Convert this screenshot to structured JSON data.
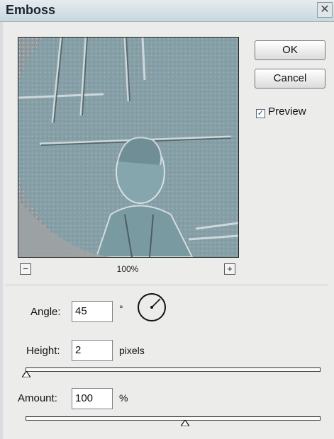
{
  "dialog": {
    "title": "Emboss",
    "close_glyph": "✕",
    "buttons": {
      "ok": "OK",
      "cancel": "Cancel"
    },
    "preview_checkbox": {
      "label": "Preview",
      "checked": true,
      "check_glyph": "✓"
    },
    "zoom": {
      "level": "100%",
      "zoom_out_glyph": "−",
      "zoom_in_glyph": "+"
    },
    "angle": {
      "label": "Angle:",
      "value": "45",
      "unit": "°"
    },
    "height": {
      "label": "Height:",
      "value": "2",
      "unit": "pixels",
      "slider_fraction": 0.01
    },
    "amount": {
      "label": "Amount:",
      "value": "100",
      "unit": "%",
      "slider_fraction": 0.5
    }
  },
  "colors": {
    "dialog_bg": "#ececea",
    "emboss_tint": "#7fa3ad",
    "title_text": "#1b2430"
  },
  "icons": {
    "angle_dial": "angle-dial-icon",
    "zoom_in": "zoom-in-icon",
    "zoom_out": "zoom-out-icon",
    "slider_thumb": "triangle-slider-thumb-icon",
    "close": "close-icon"
  }
}
